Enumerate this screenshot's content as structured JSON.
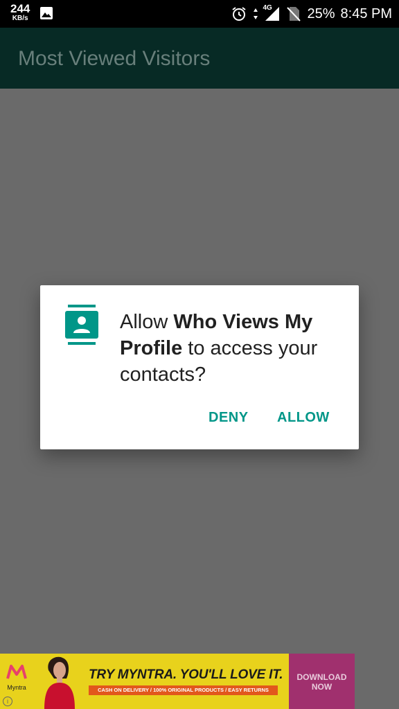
{
  "status_bar": {
    "net_speed": "244",
    "net_speed_unit": "KB/s",
    "network_type": "4G",
    "battery": "25%",
    "time": "8:45 PM",
    "icons": [
      "image-icon",
      "alarm-icon",
      "data-arrows-icon",
      "signal-icon",
      "no-sim-icon"
    ]
  },
  "app_bar": {
    "title": "Most Viewed Visitors"
  },
  "dialog": {
    "icon": "contacts-icon",
    "message_prefix": "Allow ",
    "app_name": "Who Views My Profile",
    "message_suffix": " to access your contacts?",
    "deny_label": "DENY",
    "allow_label": "ALLOW",
    "accent_color": "#009688"
  },
  "ad_banner": {
    "brand": "Myntra",
    "headline": "TRY MYNTRA. YOU'LL LOVE IT.",
    "subtext": "CASH ON DELIVERY / 100% ORIGINAL PRODUCTS / EASY RETURNS",
    "cta_line1": "DOWNLOAD",
    "cta_line2": "NOW",
    "info_icon": "info-icon",
    "colors": {
      "background": "#e8d21c",
      "cta": "#a0306e",
      "subtext_bg": "#e2571c"
    }
  },
  "colors": {
    "app_bar": "#072a25",
    "scrim": "#6a6a6a"
  }
}
